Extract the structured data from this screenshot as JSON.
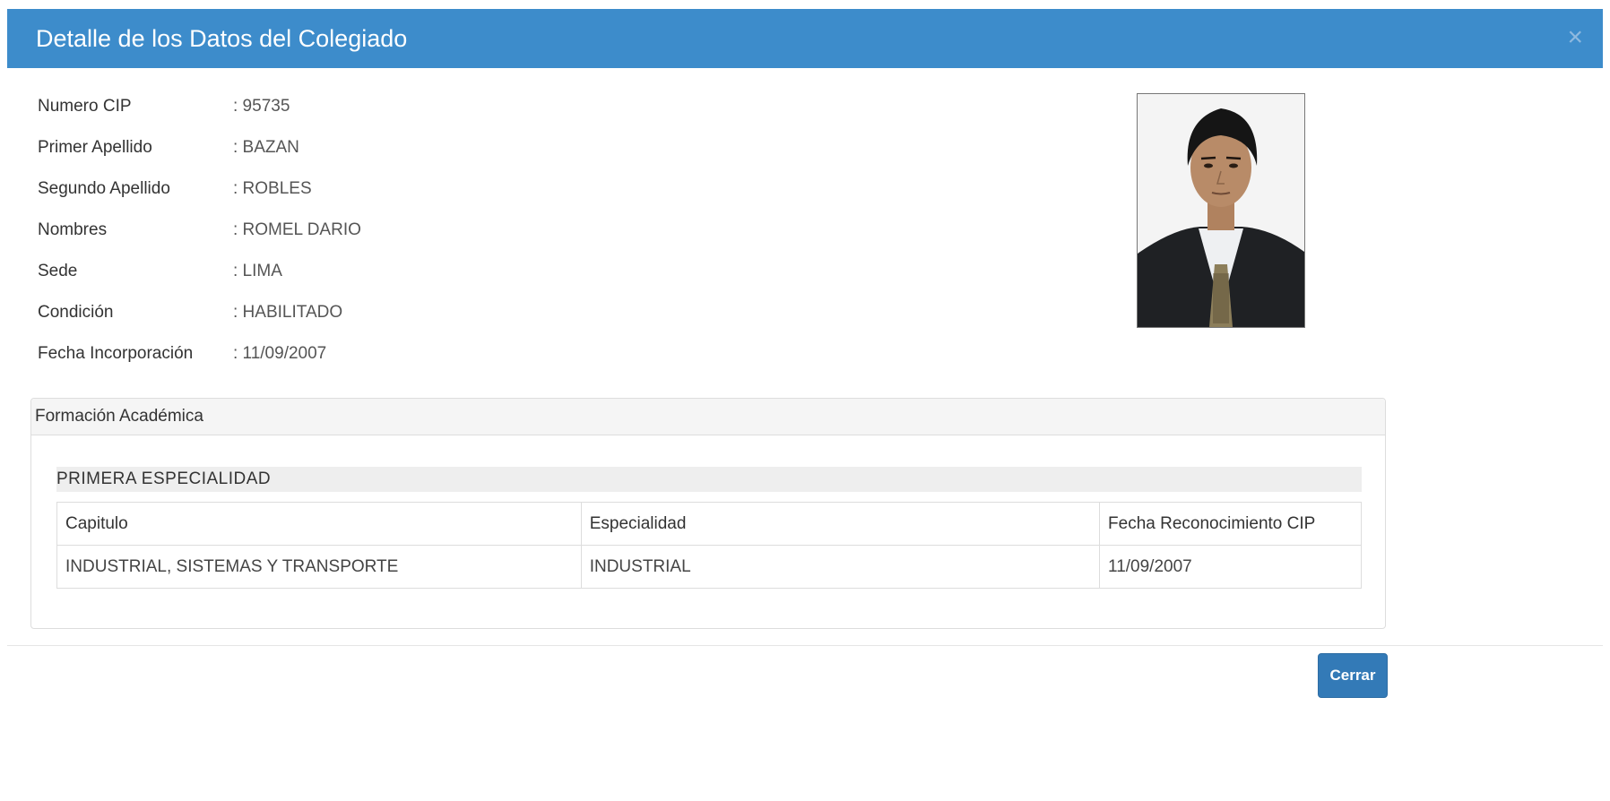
{
  "modal": {
    "title": "Detalle de los Datos del Colegiado",
    "close_icon": "close-icon",
    "header_color": "#3d8ccb"
  },
  "fields": [
    {
      "label": "Numero CIP",
      "value": ": 95735"
    },
    {
      "label": "Primer Apellido",
      "value": ": BAZAN"
    },
    {
      "label": "Segundo Apellido",
      "value": ": ROBLES"
    },
    {
      "label": "Nombres",
      "value": ": ROMEL DARIO"
    },
    {
      "label": "Sede",
      "value": ": LIMA"
    },
    {
      "label": "Condición",
      "value": ": HABILITADO"
    },
    {
      "label": "Fecha Incorporación",
      "value": ": 11/09/2007"
    }
  ],
  "photo": {
    "icon": "member-photo"
  },
  "panel": {
    "title": "Formación Académica",
    "section_title": "PRIMERA ESPECIALIDAD",
    "table": {
      "headers": [
        "Capitulo",
        "Especialidad",
        "Fecha Reconocimiento CIP"
      ],
      "rows": [
        [
          "INDUSTRIAL, SISTEMAS Y TRANSPORTE",
          "INDUSTRIAL",
          "11/09/2007"
        ]
      ]
    }
  },
  "footer": {
    "close_button": "Cerrar",
    "button_color": "#337ab7"
  }
}
